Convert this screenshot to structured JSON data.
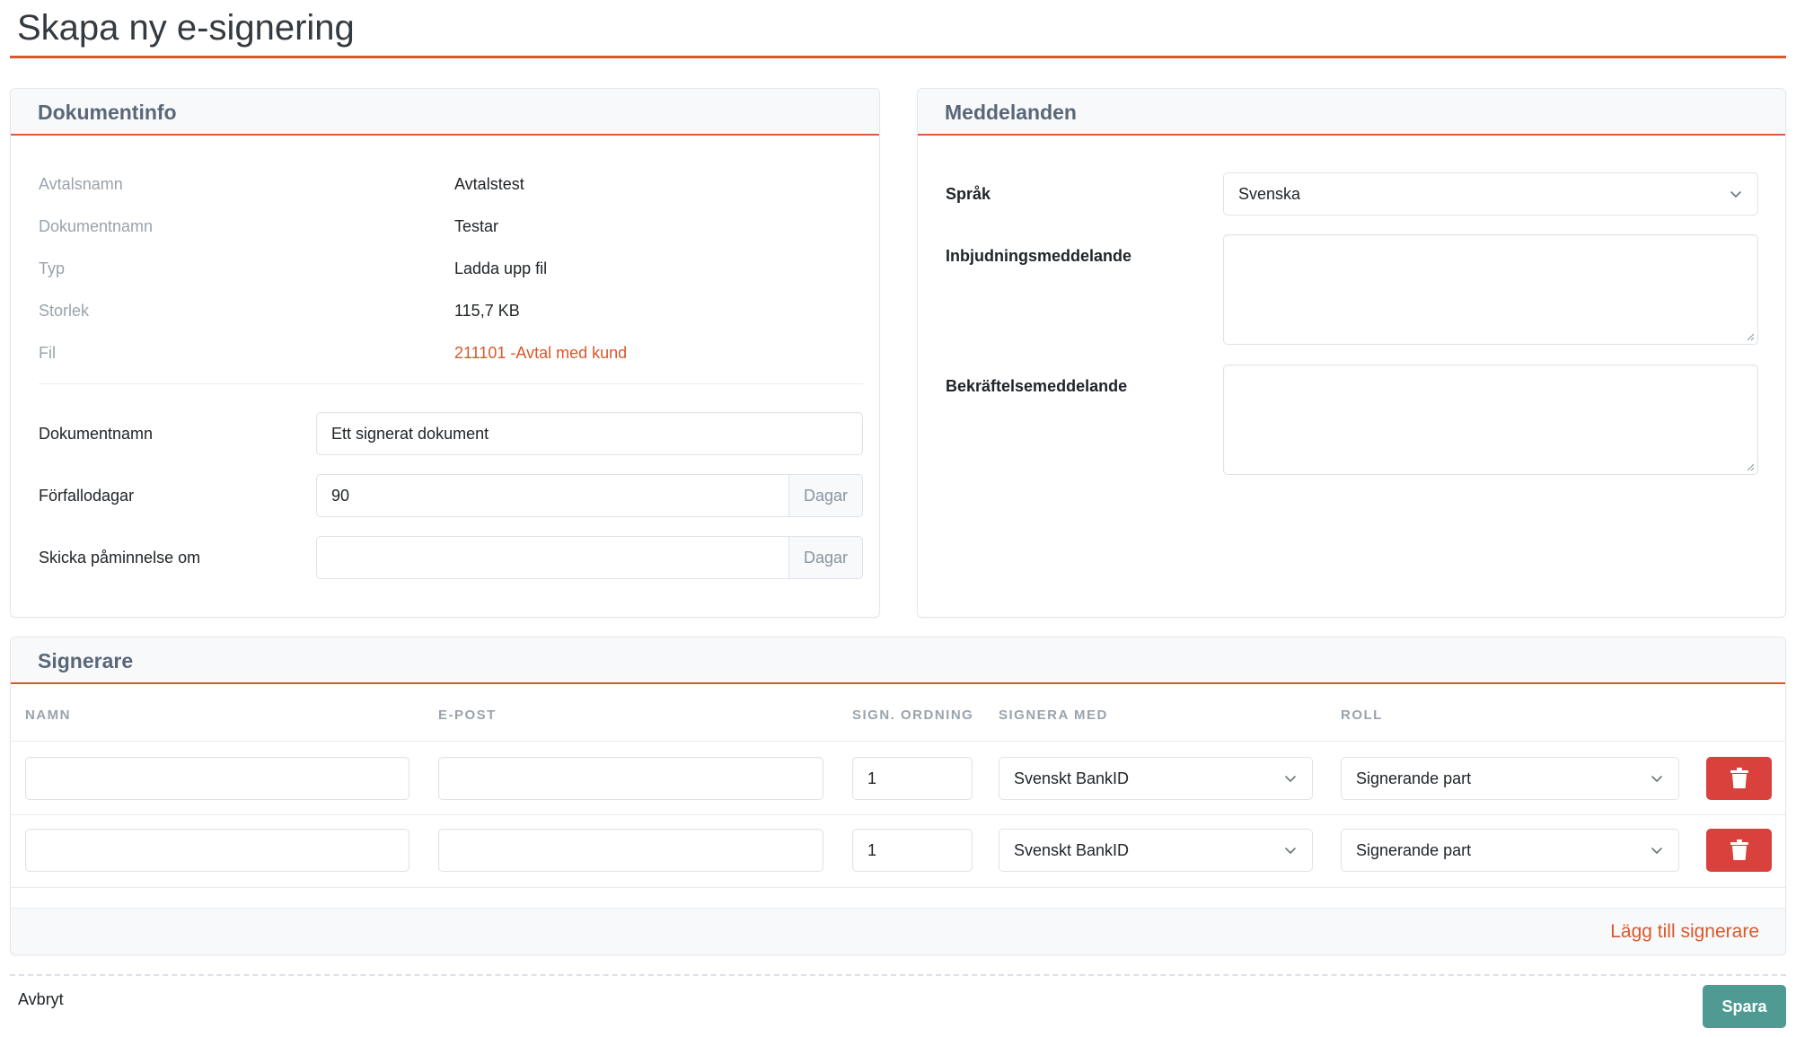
{
  "page": {
    "title": "Skapa ny e-signering"
  },
  "docinfo": {
    "header": "Dokumentinfo",
    "rows": [
      {
        "label": "Avtalsnamn",
        "value": "Avtalstest"
      },
      {
        "label": "Dokumentnamn",
        "value": "Testar"
      },
      {
        "label": "Typ",
        "value": "Ladda upp fil"
      },
      {
        "label": "Storlek",
        "value": "115,7 KB"
      },
      {
        "label": "Fil",
        "value": "211101 -Avtal med kund"
      }
    ],
    "form": {
      "docname_label": "Dokumentnamn",
      "docname_value": "Ett signerat dokument",
      "expiry_label": "Förfallodagar",
      "expiry_value": "90",
      "expiry_addon": "Dagar",
      "reminder_label": "Skicka påminnelse om",
      "reminder_value": "",
      "reminder_addon": "Dagar"
    }
  },
  "messages": {
    "header": "Meddelanden",
    "language_label": "Språk",
    "language_value": "Svenska",
    "invitation_label": "Inbjudningsmeddelande",
    "invitation_value": "",
    "confirmation_label": "Bekräftelsemeddelande",
    "confirmation_value": ""
  },
  "signers": {
    "header": "Signerare",
    "columns": [
      "NAMN",
      "E-POST",
      "SIGN. ORDNING",
      "SIGNERA MED",
      "ROLL"
    ],
    "rows": [
      {
        "name": "",
        "email": "",
        "order": "1",
        "method": "Svenskt BankID",
        "role": "Signerande part"
      },
      {
        "name": "",
        "email": "",
        "order": "1",
        "method": "Svenskt BankID",
        "role": "Signerande part"
      }
    ],
    "add_label": "Lägg till signerare"
  },
  "footer": {
    "cancel_label": "Avbryt",
    "save_label": "Spara"
  },
  "colors": {
    "accent": "#d9582b",
    "danger": "#d9413d",
    "save": "#4f9b93"
  },
  "icons": {
    "select": "chevron-down-icon",
    "delete": "trash-icon",
    "textarea": "resize-grip-icon"
  }
}
